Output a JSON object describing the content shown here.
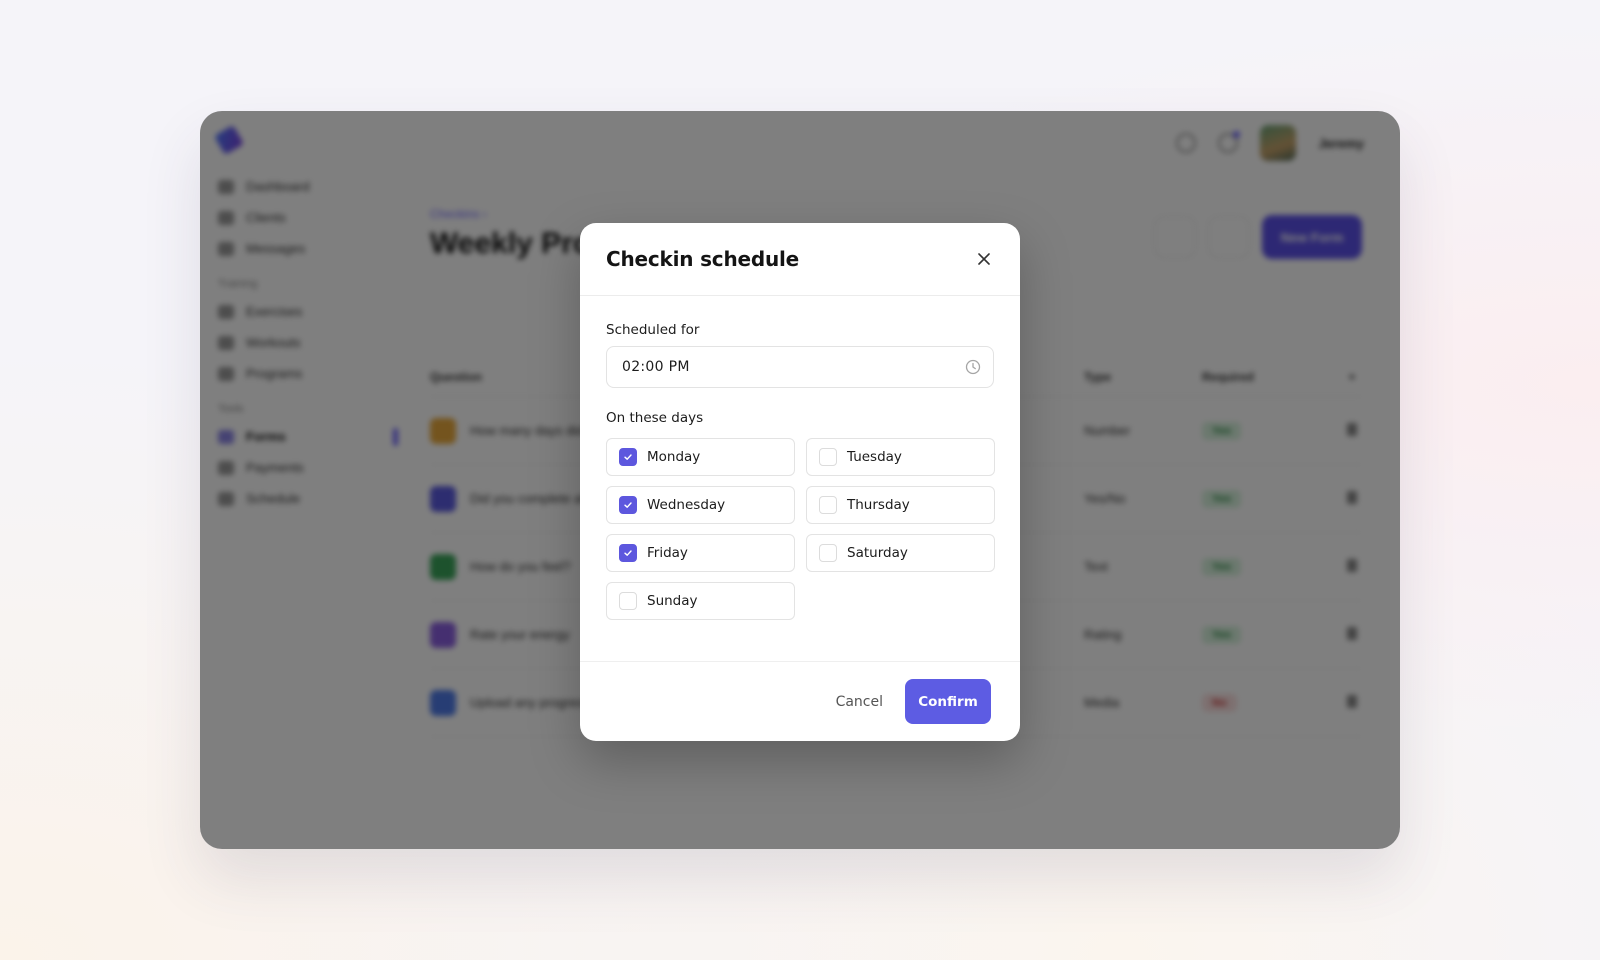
{
  "app": {
    "sidebar": {
      "items": [
        {
          "label": "Dashboard"
        },
        {
          "label": "Clients"
        },
        {
          "label": "Messages"
        }
      ],
      "sections": [
        {
          "title": "Training",
          "items": [
            {
              "label": "Exercises"
            },
            {
              "label": "Workouts"
            },
            {
              "label": "Programs"
            }
          ]
        },
        {
          "title": "Tools",
          "items": [
            {
              "label": "Forms",
              "active": true
            },
            {
              "label": "Payments"
            },
            {
              "label": "Schedule"
            }
          ]
        }
      ]
    },
    "topbar": {
      "icons": [
        "chat-icon",
        "bell-icon"
      ],
      "username": "Jeremy"
    },
    "header": {
      "breadcrumb": "Checkins",
      "breadcrumb_separator": "›",
      "title": "Weekly Progress",
      "primary_button": "New Form"
    },
    "table": {
      "columns": [
        "Question",
        "Type",
        "Required"
      ],
      "rows": [
        {
          "question": "How many days did you train?",
          "type": "Number",
          "required": "Yes",
          "icon_color": "#e9a93c"
        },
        {
          "question": "Did you complete all workouts?",
          "type": "Yes/No",
          "required": "Yes",
          "icon_color": "#5b5be0"
        },
        {
          "question": "How do you feel?",
          "type": "Text",
          "required": "Yes",
          "icon_color": "#3aa55a"
        },
        {
          "question": "Rate your energy",
          "type": "Rating",
          "required": "Yes",
          "icon_color": "#8b5fe0"
        },
        {
          "question": "Upload any progress photos",
          "type": "Media",
          "required": "No",
          "icon_color": "#4f7be8"
        }
      ]
    }
  },
  "modal": {
    "title": "Checkin schedule",
    "scheduled_label": "Scheduled for",
    "time_value": "02:00 PM",
    "days_label": "On these days",
    "days": [
      {
        "label": "Monday",
        "checked": true
      },
      {
        "label": "Tuesday",
        "checked": false
      },
      {
        "label": "Wednesday",
        "checked": true
      },
      {
        "label": "Thursday",
        "checked": false
      },
      {
        "label": "Friday",
        "checked": true
      },
      {
        "label": "Saturday",
        "checked": false
      },
      {
        "label": "Sunday",
        "checked": false
      }
    ],
    "cancel_label": "Cancel",
    "confirm_label": "Confirm"
  },
  "colors": {
    "accent": "#5d5ce3",
    "checkbox_checked": "#5d57de",
    "overlay": "rgba(0,0,0,0.5)"
  }
}
